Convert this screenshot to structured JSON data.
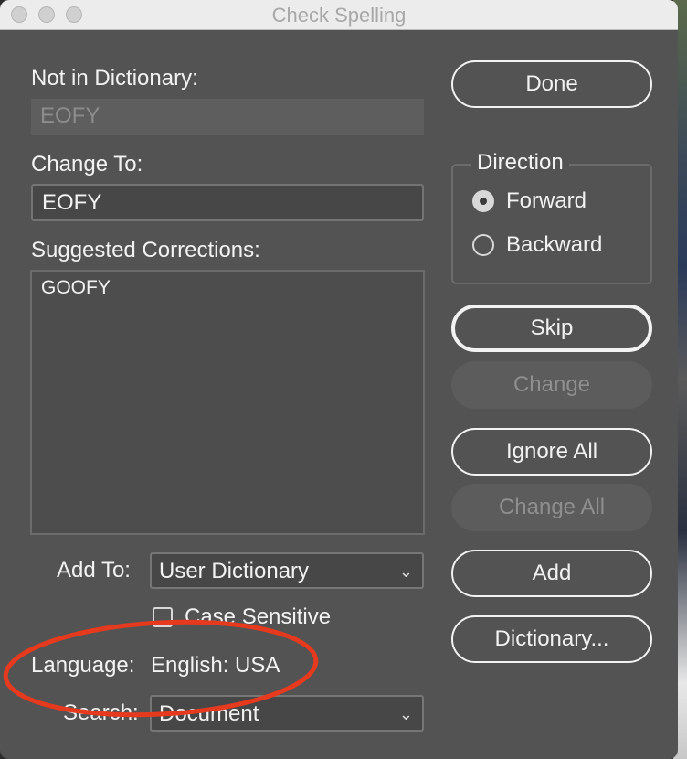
{
  "window": {
    "title": "Check Spelling"
  },
  "not_in_dictionary": {
    "label": "Not in Dictionary:",
    "value": "EOFY"
  },
  "change_to": {
    "label": "Change To:",
    "value": "EOFY"
  },
  "suggested": {
    "label": "Suggested Corrections:",
    "items": [
      "GOOFY"
    ]
  },
  "add_to": {
    "label": "Add To:",
    "value": "User Dictionary"
  },
  "case_sensitive": {
    "label": "Case Sensitive",
    "checked": false
  },
  "language": {
    "label": "Language:",
    "value": "English: USA"
  },
  "search": {
    "label": "Search:",
    "value": "Document"
  },
  "direction": {
    "title": "Direction",
    "options": [
      {
        "label": "Forward",
        "selected": true
      },
      {
        "label": "Backward",
        "selected": false
      }
    ]
  },
  "buttons": {
    "done": "Done",
    "skip": "Skip",
    "change": "Change",
    "ignore_all": "Ignore All",
    "change_all": "Change All",
    "add": "Add",
    "dictionary": "Dictionary..."
  },
  "colors": {
    "annotation_circle": "#e63a1f",
    "panel": "#535353"
  }
}
